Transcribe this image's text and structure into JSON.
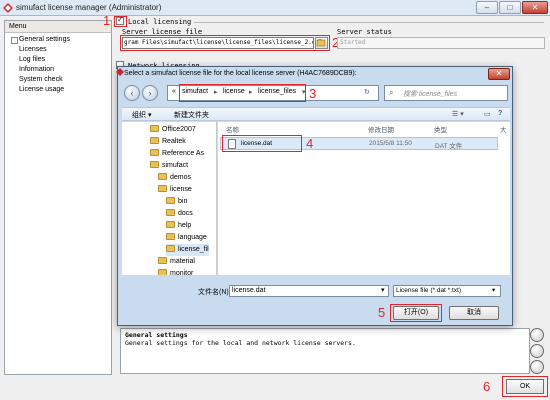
{
  "app": {
    "title": "simufact license manager (Administrator)",
    "window_controls": [
      "–",
      "□",
      "✕"
    ]
  },
  "menu": {
    "header": "Menu",
    "items": [
      {
        "label": "General settings",
        "selected": true
      },
      {
        "label": "Licenses"
      },
      {
        "label": "Log files"
      },
      {
        "label": "Information"
      },
      {
        "label": "System check"
      },
      {
        "label": "License usage"
      }
    ]
  },
  "local_licensing": {
    "checkbox_label": "Local licensing",
    "checked": true,
    "server_license_file_label": "Server license file",
    "path_value": "gram Files\\simufact\\license\\license_files\\license_2.dat",
    "server_status_label": "Server status",
    "status_value": "Started"
  },
  "network_licensing": {
    "checkbox_label": "Network licensing"
  },
  "description": {
    "title": "General settings",
    "text": "General settings for the local and network license servers."
  },
  "ok_button": "OK",
  "annotations": [
    "1",
    "2",
    "3",
    "4",
    "5",
    "6"
  ],
  "dialog": {
    "title": "Select a simufact license file for the local license server (H4AC7689DCB9):",
    "close": "✕",
    "breadcrumb": [
      "«",
      "simufact",
      "license",
      "license_files"
    ],
    "search_placeholder": "搜索 license_files",
    "toolbar": {
      "organize": "组织 ▾",
      "new_folder": "新建文件夹"
    },
    "folders": [
      {
        "label": "Office2007"
      },
      {
        "label": "Realtek"
      },
      {
        "label": "Reference As"
      },
      {
        "label": "simufact"
      },
      {
        "label": "demos"
      },
      {
        "label": "license"
      },
      {
        "label": "bin"
      },
      {
        "label": "docs"
      },
      {
        "label": "help"
      },
      {
        "label": "language"
      },
      {
        "label": "license_fil"
      },
      {
        "label": "material"
      },
      {
        "label": "monitor"
      }
    ],
    "columns": {
      "name": "名称",
      "modified": "修改日期",
      "type": "类型",
      "size": "大"
    },
    "files": [
      {
        "name": "license.dat",
        "modified": "2015/5/8 11:50",
        "type": "DAT 文件"
      }
    ],
    "filename_label": "文件名(N):",
    "filename_value": "license.dat",
    "filetype_value": "License file (*.dat *.txt)",
    "open_button": "打开(O)",
    "cancel_button": "取消"
  },
  "colors": {
    "annotation_red": "#e0262a",
    "selection_blue": "#dbe9f8",
    "dialog_frame": "#c9dcef"
  }
}
